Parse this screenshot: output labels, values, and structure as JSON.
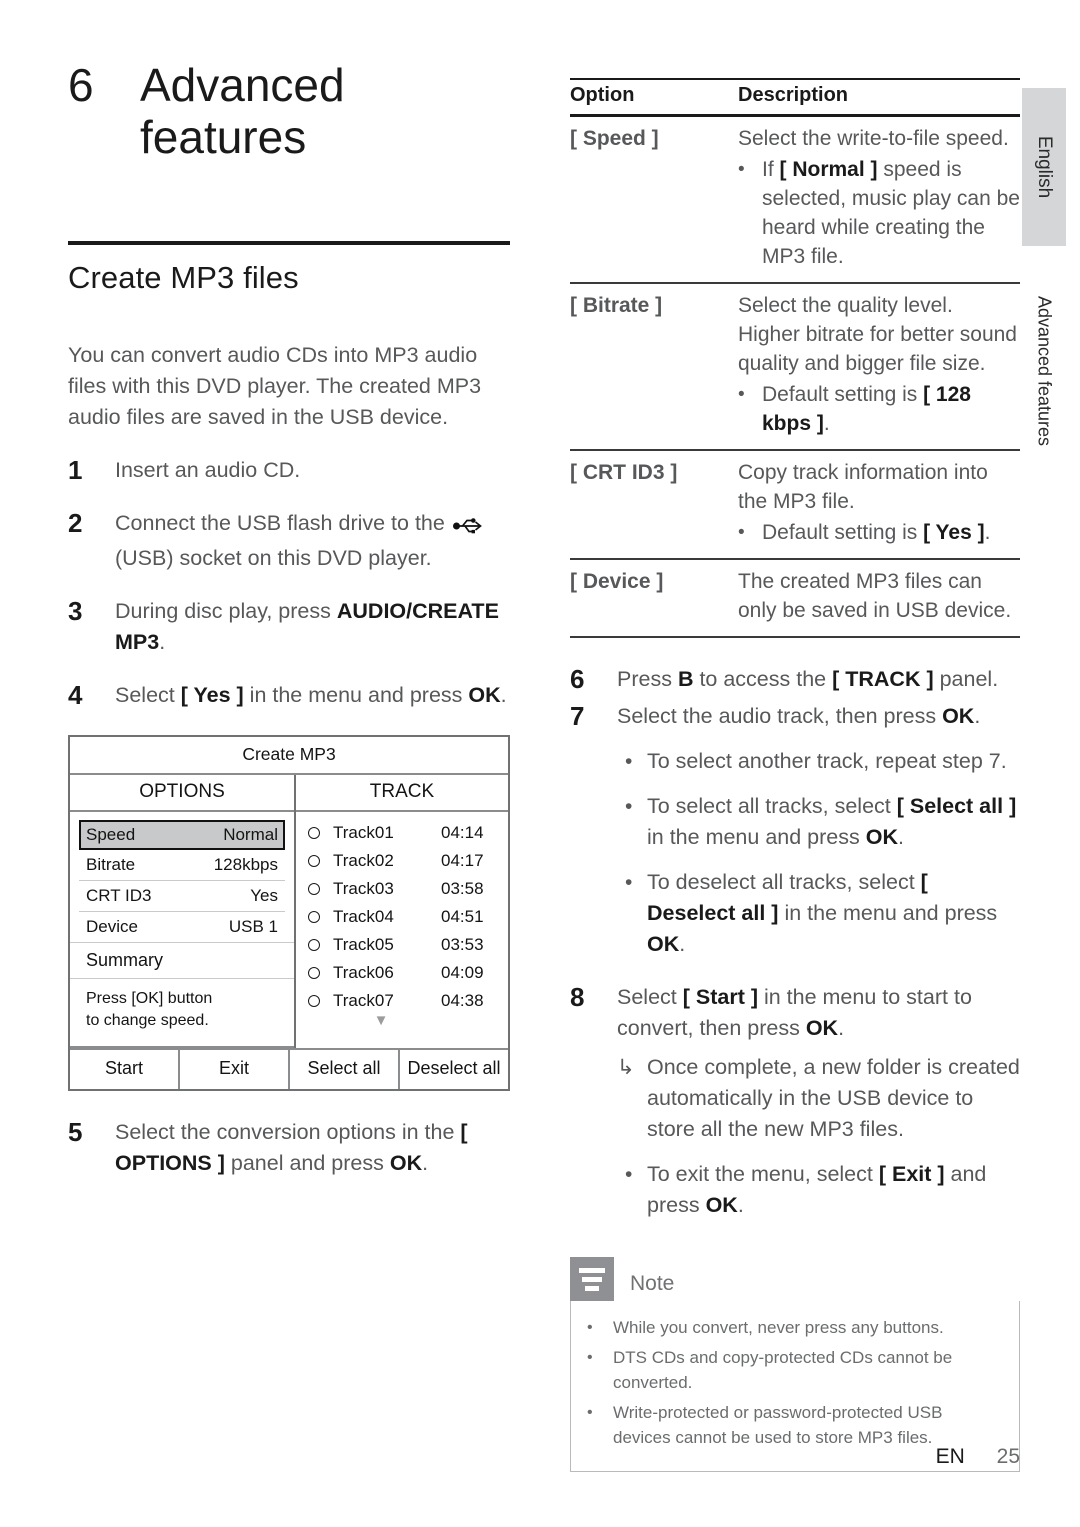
{
  "chapter": {
    "number": "6",
    "title_line1": "Advanced",
    "title_line2": "features"
  },
  "section": {
    "heading": "Create MP3 files",
    "intro": "You can convert audio CDs into MP3 audio files with this DVD player. The created MP3 audio files are saved in the USB device."
  },
  "steps_left": [
    {
      "num": "1",
      "text": "Insert an audio CD."
    },
    {
      "num": "2",
      "text_before": "Connect the USB flash drive to the ",
      "icon": "usb-icon",
      "text_after": " (USB) socket on this DVD player."
    },
    {
      "num": "3",
      "text_before": "During disc play, press ",
      "bold": "AUDIO/CREATE MP3",
      "text_after": "."
    },
    {
      "num": "4",
      "text_before": "Select ",
      "bold": "[ Yes ]",
      "text_mid": " in the menu and press ",
      "bold2": "OK",
      "text_after": "."
    },
    {
      "num": "5",
      "text_before": "Select the conversion options in the ",
      "bold": "[ OPTIONS ]",
      "text_mid": " panel and press ",
      "bold2": "OK",
      "text_after": "."
    }
  ],
  "osd": {
    "title": "Create MP3",
    "options_header": "OPTIONS",
    "track_header": "TRACK",
    "options": [
      {
        "key": "Speed",
        "value": "Normal",
        "selected": true
      },
      {
        "key": "Bitrate",
        "value": "128kbps",
        "selected": false
      },
      {
        "key": "CRT ID3",
        "value": "Yes",
        "selected": false
      },
      {
        "key": "Device",
        "value": "USB 1",
        "selected": false
      }
    ],
    "summary_label": "Summary",
    "hint_line1": "Press [OK] button",
    "hint_line2": "to change speed.",
    "tracks": [
      {
        "name": "Track01",
        "time": "04:14"
      },
      {
        "name": "Track02",
        "time": "04:17"
      },
      {
        "name": "Track03",
        "time": "03:58"
      },
      {
        "name": "Track04",
        "time": "04:51"
      },
      {
        "name": "Track05",
        "time": "03:53"
      },
      {
        "name": "Track06",
        "time": "04:09"
      },
      {
        "name": "Track07",
        "time": "04:38"
      }
    ],
    "scroll_arrow": "▼",
    "buttons": {
      "start": "Start",
      "exit": "Exit",
      "select_all": "Select all",
      "deselect_all": "Deselect all"
    }
  },
  "option_table": {
    "header_option": "Option",
    "header_description": "Description",
    "rows": [
      {
        "option": "[ Speed ]",
        "desc": "Select the write-to-file speed.",
        "bullet_pre": "If ",
        "bullet_bold": "[ Normal ]",
        "bullet_post": " speed is selected, music play can be heard while creating the MP3 file."
      },
      {
        "option": "[ Bitrate ]",
        "desc": "Select the quality level. Higher bitrate for better sound quality and bigger file size.",
        "bullet_pre": "Default setting is ",
        "bullet_bold": "[ 128 kbps ]",
        "bullet_post": "."
      },
      {
        "option": "[ CRT ID3 ]",
        "desc": "Copy track information into the MP3 file.",
        "bullet_pre": "Default setting is ",
        "bullet_bold": "[ Yes ]",
        "bullet_post": "."
      },
      {
        "option": "[ Device ]",
        "desc": "The created MP3 files can only be saved in USB device.",
        "bullet_pre": "",
        "bullet_bold": "",
        "bullet_post": ""
      }
    ]
  },
  "steps_right": {
    "step6": {
      "num": "6",
      "pre": "Press ",
      "bold1": "B",
      "mid": " to access the ",
      "bold2": "[ TRACK ]",
      "post": " panel."
    },
    "step7": {
      "num": "7",
      "pre": "Select the audio track, then press ",
      "bold1": "OK",
      "post": "."
    },
    "step7_bullets": [
      {
        "pre": "To select another track, repeat step 7.",
        "bold": "",
        "post": ""
      },
      {
        "pre": "To select all tracks, select ",
        "bold": "[ Select all ]",
        "mid": " in the menu and press ",
        "bold2": "OK",
        "post": "."
      },
      {
        "pre": "To deselect all tracks, select ",
        "bold": "[ Deselect all ]",
        "mid": " in the menu and press ",
        "bold2": "OK",
        "post": "."
      }
    ],
    "step8": {
      "num": "8",
      "pre": "Select ",
      "bold1": "[ Start ]",
      "mid": " in the menu to start to convert, then press ",
      "bold2": "OK",
      "post": "."
    },
    "step8_arrow": {
      "glyph": "↳",
      "text": "Once complete, a new folder is created automatically in the USB device to store all the new MP3 files."
    },
    "step8_bullet": {
      "pre": "To exit the menu, select ",
      "bold": "[ Exit ]",
      "mid": " and press ",
      "bold2": "OK",
      "post": "."
    }
  },
  "note": {
    "label": "Note",
    "items": [
      "While you convert, never press any buttons.",
      "DTS CDs and copy-protected CDs cannot be converted.",
      "Write-protected or password-protected USB devices cannot be used to store MP3 files."
    ]
  },
  "side_tabs": {
    "language": "English",
    "section": "Advanced features"
  },
  "footer": {
    "lang_code": "EN",
    "page_number": "25"
  },
  "colors": {
    "tab_bg": "#d5d6d7",
    "note_badge": "#8e9093",
    "selected_row": "#c8c9ca",
    "body_text": "#57585a",
    "heading_text": "#1a1a1a"
  }
}
